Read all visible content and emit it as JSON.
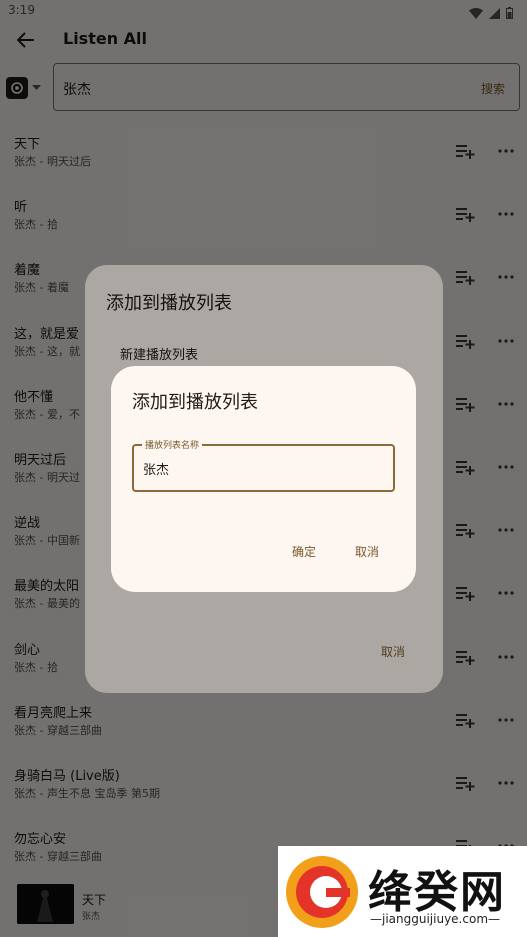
{
  "status_bar": {
    "time": "3:19"
  },
  "app_bar": {
    "title": "Listen All"
  },
  "search": {
    "value": "张杰",
    "button_label": "搜索"
  },
  "songs": [
    {
      "title": "天下",
      "subtitle": "张杰 - 明天过后"
    },
    {
      "title": "听",
      "subtitle": "张杰 - 拾"
    },
    {
      "title": "着魔",
      "subtitle": "张杰 - 着魔"
    },
    {
      "title": "这，就是爱",
      "subtitle": "张杰 - 这，就"
    },
    {
      "title": "他不懂",
      "subtitle": "张杰 - 爱，不"
    },
    {
      "title": "明天过后",
      "subtitle": "张杰 - 明天过"
    },
    {
      "title": "逆战",
      "subtitle": "张杰 - 中国新"
    },
    {
      "title": "最美的太阳",
      "subtitle": "张杰 - 最美的"
    },
    {
      "title": "剑心",
      "subtitle": "张杰 - 拾"
    },
    {
      "title": "看月亮爬上来",
      "subtitle": "张杰 - 穿越三部曲"
    },
    {
      "title": "身骑白马 (Live版)",
      "subtitle": "张杰 - 声生不息 宝岛季 第5期"
    },
    {
      "title": "勿忘心安",
      "subtitle": "张杰 - 穿越三部曲"
    }
  ],
  "mini_player": {
    "title": "天下",
    "artist": "张杰"
  },
  "dialog_playlists": {
    "title": "添加到播放列表",
    "new_playlist": "新建播放列表",
    "cancel": "取消"
  },
  "dialog_new": {
    "title": "添加到播放列表",
    "field_label": "播放列表名称",
    "field_value": "张杰",
    "confirm": "确定",
    "cancel": "取消"
  },
  "watermark": {
    "name": "绛癸网",
    "url": "—jiangguijiuye.com—"
  },
  "colors": {
    "accent": "#7a5a2a",
    "field_border": "#8a6a35",
    "surface": "#fdf6f1",
    "background": "#fbf7f3"
  }
}
